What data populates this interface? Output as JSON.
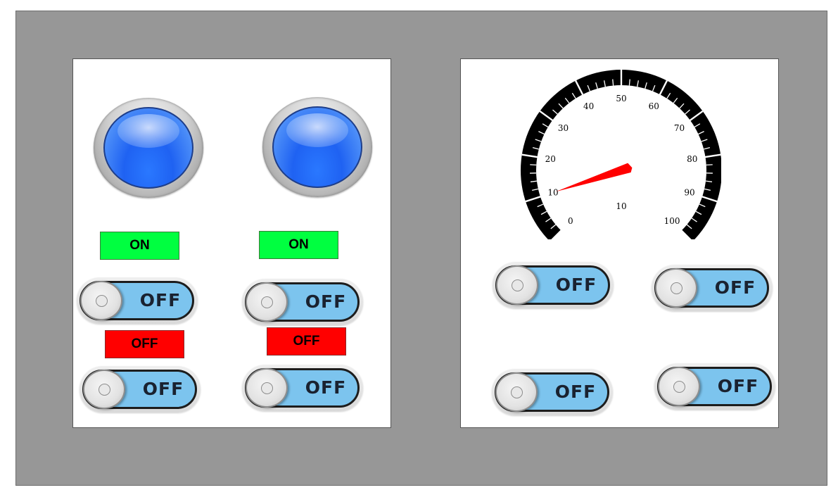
{
  "left_panel": {
    "lamps": [
      {
        "name": "indicator-lamp-1",
        "color": "#2a78ff"
      },
      {
        "name": "indicator-lamp-2",
        "color": "#2a78ff"
      }
    ],
    "status_labels": [
      {
        "text": "ON",
        "color": "#00ff40"
      },
      {
        "text": "ON",
        "color": "#00ff40"
      },
      {
        "text": "OFF",
        "color": "#ff0000"
      },
      {
        "text": "OFF",
        "color": "#ff0000"
      }
    ],
    "toggles": [
      {
        "label": "OFF",
        "state": "off"
      },
      {
        "label": "OFF",
        "state": "off"
      },
      {
        "label": "OFF",
        "state": "off"
      },
      {
        "label": "OFF",
        "state": "off"
      }
    ]
  },
  "right_panel": {
    "gauge": {
      "min": 0,
      "max": 100,
      "value": 10,
      "major_tick_labels": [
        "0",
        "10",
        "20",
        "30",
        "40",
        "50",
        "60",
        "70",
        "80",
        "90",
        "100"
      ],
      "center_label": "10",
      "needle_color": "#ff0000"
    },
    "toggles": [
      {
        "label": "OFF",
        "state": "off"
      },
      {
        "label": "OFF",
        "state": "off"
      },
      {
        "label": "OFF",
        "state": "off"
      },
      {
        "label": "OFF",
        "state": "off"
      }
    ]
  },
  "colors": {
    "background": "#979797",
    "panel": "#ffffff",
    "toggle_track": "#7cc4ee",
    "status_on": "#00ff40",
    "status_off": "#ff0000"
  }
}
